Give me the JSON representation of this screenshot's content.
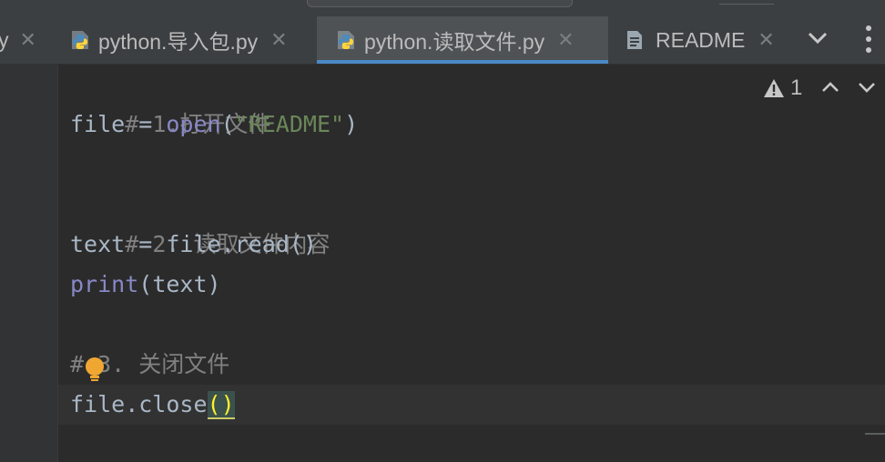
{
  "tabs": [
    {
      "label": "y",
      "partial": true
    },
    {
      "label": "python.导入包.py",
      "icon": "python-file-icon"
    },
    {
      "label": "python.读取文件.py",
      "icon": "python-file-icon",
      "active": true
    },
    {
      "label": "README",
      "icon": "text-file-icon"
    }
  ],
  "editor": {
    "lines": [
      "# 1.打开文件",
      "file = open(\"README\")",
      "",
      "# 2. 读取文件内容",
      "text = file.read()",
      "print(text)",
      "",
      "# 3. 关闭文件",
      "file.close()"
    ],
    "tokens": {
      "l0_comment": "# 1.打开文件",
      "l1_a": "file = ",
      "l1_kw": "open",
      "l1_b": "(",
      "l1_str": "\"README\"",
      "l1_c": ")",
      "l3_comment": "# 2. 读取文件内容",
      "l4_a": "text = file.read()",
      "l5_kw": "print",
      "l5_b": "(text)",
      "l7_comment_a": "#",
      "l7_comment_b": " 3. 关闭文件",
      "l8_a": "file.close",
      "l8_open": "(",
      "l8_close": ")"
    }
  },
  "inspection": {
    "warning_count": "1",
    "icon": "warning-icon"
  },
  "colors": {
    "accent": "#4a88c7",
    "comment": "#808080",
    "keyword": "#8888c6",
    "string": "#6a8759",
    "text": "#a9b7c6",
    "bulb": "#f0a732"
  }
}
